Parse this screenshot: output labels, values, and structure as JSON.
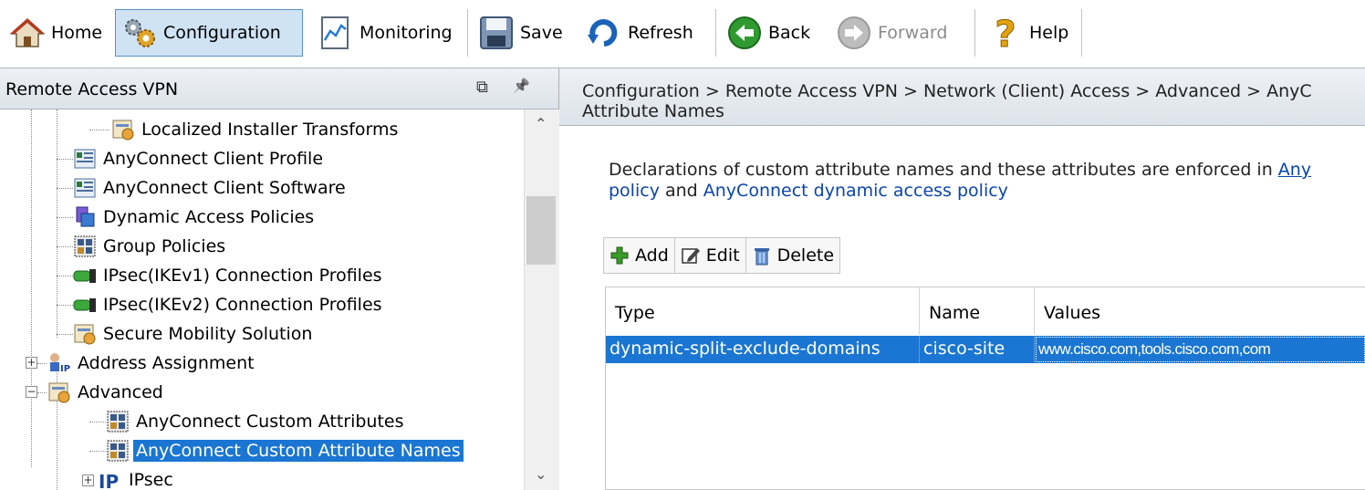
{
  "toolbar": {
    "home": "Home",
    "configuration": "Configuration",
    "monitoring": "Monitoring",
    "save": "Save",
    "refresh": "Refresh",
    "back": "Back",
    "forward": "Forward",
    "help": "Help"
  },
  "left_panel": {
    "title": "Remote Access VPN",
    "restore_glyph": "⧉",
    "pin_glyph": "📌",
    "tree": [
      {
        "label": "Localized Installer Transforms",
        "icon": "transforms-icon"
      },
      {
        "label": "AnyConnect Client Profile",
        "icon": "profile-icon"
      },
      {
        "label": "AnyConnect Client Software",
        "icon": "software-icon"
      },
      {
        "label": "Dynamic Access Policies",
        "icon": "policy-icon"
      },
      {
        "label": "Group Policies",
        "icon": "group-icon"
      },
      {
        "label": "IPsec(IKEv1) Connection Profiles",
        "icon": "connection-icon"
      },
      {
        "label": "IPsec(IKEv2) Connection Profiles",
        "icon": "connection-icon"
      },
      {
        "label": "Secure Mobility Solution",
        "icon": "mobility-icon"
      },
      {
        "label": "Address Assignment",
        "icon": "address-icon"
      },
      {
        "label": "Advanced",
        "icon": "advanced-icon"
      },
      {
        "label": "AnyConnect Custom Attributes",
        "icon": "attributes-icon"
      },
      {
        "label": "AnyConnect Custom Attribute Names",
        "icon": "attributes-icon"
      },
      {
        "label": "IPsec",
        "icon": "ipsec-icon"
      }
    ]
  },
  "right_panel": {
    "breadcrumb_line1": "Configuration > Remote Access VPN > Network (Client) Access > Advanced > AnyC",
    "breadcrumb_line2": "Attribute Names",
    "desc_text1": "Declarations of custom attribute names and these attributes are enforced in ",
    "desc_link1": "Any",
    "desc_link2": "policy",
    "desc_text2": " and ",
    "desc_link3": "AnyConnect dynamic access policy",
    "actions": {
      "add": "Add",
      "edit": "Edit",
      "delete": "Delete"
    },
    "table": {
      "columns": [
        "Type",
        "Name",
        "Values"
      ],
      "rows": [
        {
          "type": "dynamic-split-exclude-domains",
          "name": "cisco-site",
          "values": "www.cisco.com,tools.cisco.com,com"
        }
      ]
    }
  },
  "colors": {
    "selection": "#1a76d2",
    "link": "#0645ad",
    "active_tool": "#cfe3f5"
  }
}
